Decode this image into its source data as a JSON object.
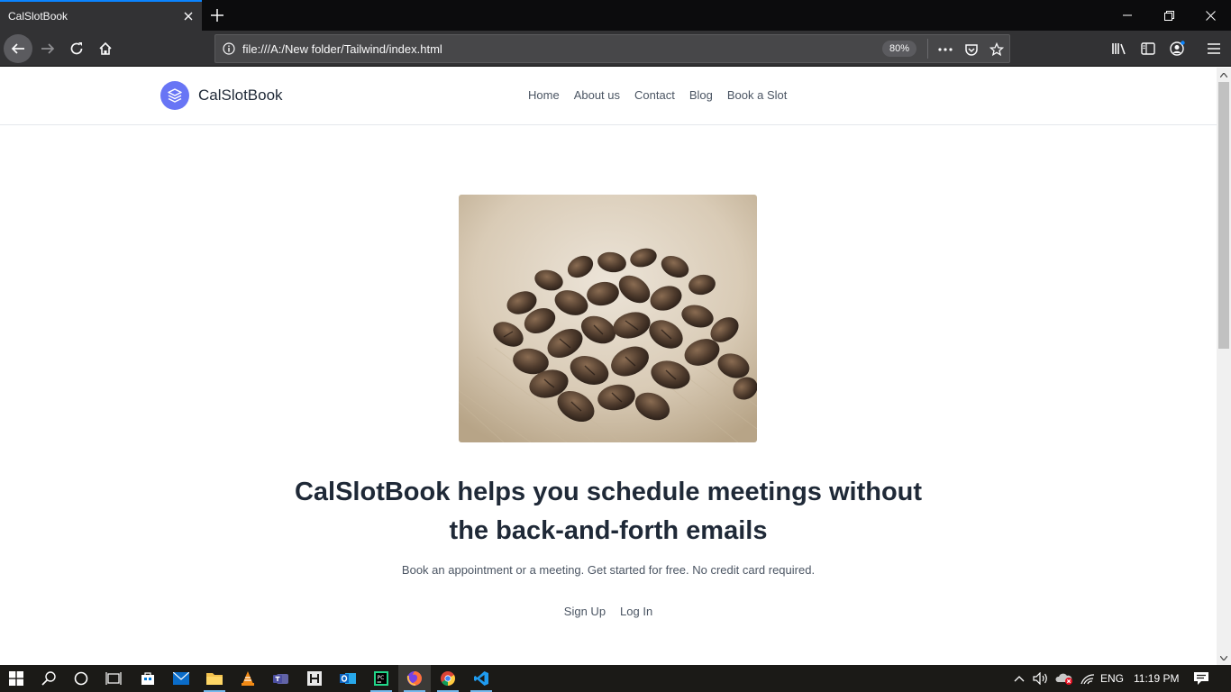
{
  "browser": {
    "tab_title": "CalSlotBook",
    "url": "file:///A:/New folder/Tailwind/index.html",
    "zoom": "80%"
  },
  "site": {
    "brand": "CalSlotBook",
    "nav": [
      "Home",
      "About us",
      "Contact",
      "Blog",
      "Book a Slot"
    ],
    "hero": {
      "title": "CalSlotBook helps you schedule meetings without the back-and-forth emails",
      "subtitle": "Book an appointment or a meeting. Get started for free. No credit card required.",
      "signup": "Sign Up",
      "login": "Log In"
    },
    "accent_color": "#6875f5"
  },
  "taskbar": {
    "language": "ENG",
    "time": "11:19 PM"
  }
}
